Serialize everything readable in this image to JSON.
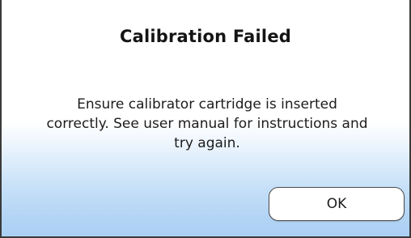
{
  "dialog": {
    "title": "Calibration Failed",
    "message_lines": [
      "Ensure calibrator cartridge is inserted",
      "correctly. See user manual for instructions and",
      "try again."
    ],
    "ok_label": "OK"
  },
  "colors": {
    "border": "#3a3a3a",
    "gradient_top": "#ffffff",
    "gradient_bottom": "#aacff3",
    "text": "#1c1c1c"
  }
}
